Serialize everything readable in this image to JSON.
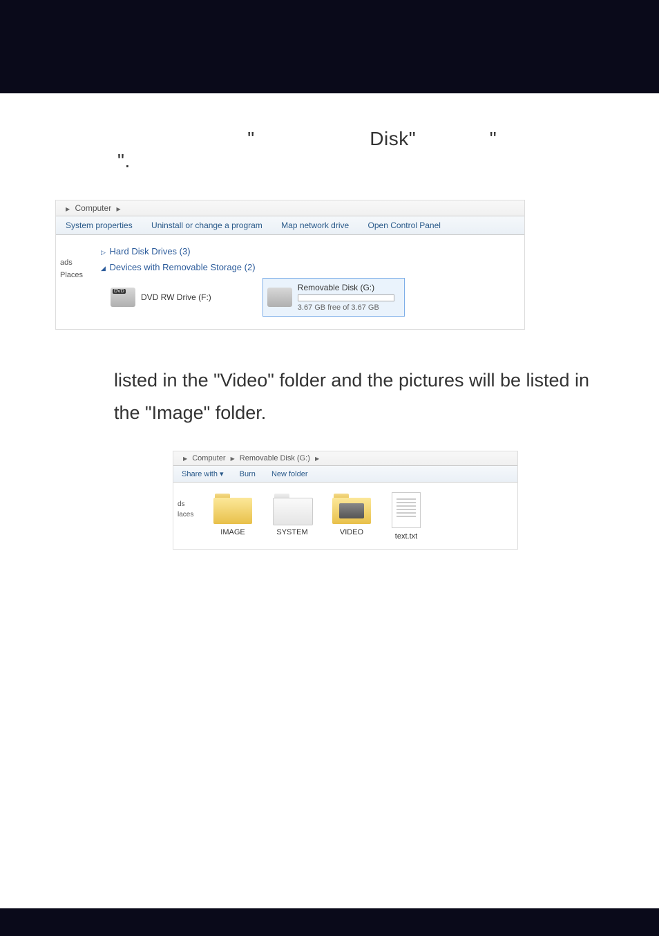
{
  "line1_parts": {
    "q1": "\"",
    "disk": "Disk\"",
    "q2": "\"",
    "q3": "\"."
  },
  "screenshot1": {
    "breadcrumb": {
      "root": "Computer"
    },
    "toolbar": {
      "sysprops": "System properties",
      "uninstall": "Uninstall or change a program",
      "mapdrive": "Map network drive",
      "opencp": "Open Control Panel"
    },
    "sidebar": {
      "ads": "ads",
      "places": "Places"
    },
    "groups": {
      "hdd": "Hard Disk Drives (3)",
      "removable": "Devices with Removable Storage (2)"
    },
    "drives": {
      "dvd": "DVD RW Drive (F:)",
      "removable_title": "Removable Disk (G:)",
      "removable_capacity": "3.67 GB free of 3.67 GB"
    }
  },
  "body_text": "listed in the \"Video\" folder and the pictures will be listed in the \"Image\" folder.",
  "screenshot2": {
    "breadcrumb": {
      "root": "Computer",
      "disk": "Removable Disk (G:)"
    },
    "toolbar": {
      "sharewith": "Share with ▾",
      "burn": "Burn",
      "newfolder": "New folder"
    },
    "sidebar": {
      "ds": "ds",
      "laces": "laces"
    },
    "items": {
      "image": "IMAGE",
      "system": "SYSTEM",
      "video": "VIDEO",
      "textfile": "text.txt"
    }
  }
}
